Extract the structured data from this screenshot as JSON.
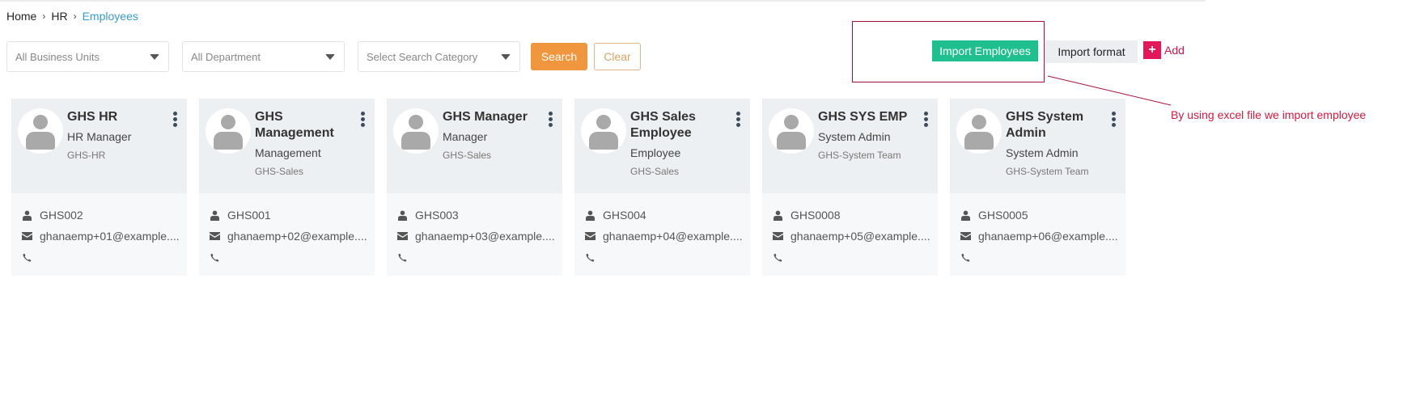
{
  "breadcrumb": [
    {
      "label": "Home"
    },
    {
      "label": "HR"
    },
    {
      "label": "Employees",
      "active": true
    }
  ],
  "breadcrumb_separator": "›",
  "filters": {
    "business_unit": {
      "value": "All Business Units"
    },
    "department": {
      "value": "All Department"
    },
    "search_category": {
      "placeholder": "Select Search Category"
    }
  },
  "buttons": {
    "search": "Search",
    "clear": "Clear",
    "import_employees": "Import Employees",
    "import_format": "Import format",
    "add": "Add",
    "add_icon": "+"
  },
  "annotation": {
    "text": "By using excel file we import employee",
    "color": "#d11a40"
  },
  "colors": {
    "search": "#ef963e",
    "import": "#1fbf8f",
    "add": "#e3175a",
    "breadcrumb_active": "#3a9ad0"
  },
  "employees": [
    {
      "name": "GHS HR",
      "role": "HR Manager",
      "unit": "GHS-HR",
      "code": "GHS002",
      "email": "ghanaemp+01@example....",
      "phone": ""
    },
    {
      "name": "GHS Management",
      "role": "Management",
      "unit": "GHS-Sales",
      "code": "GHS001",
      "email": "ghanaemp+02@example....",
      "phone": ""
    },
    {
      "name": "GHS Manager",
      "role": "Manager",
      "unit": "GHS-Sales",
      "code": "GHS003",
      "email": "ghanaemp+03@example....",
      "phone": ""
    },
    {
      "name": "GHS Sales Employee",
      "role": "Employee",
      "unit": "GHS-Sales",
      "code": "GHS004",
      "email": "ghanaemp+04@example....",
      "phone": ""
    },
    {
      "name": "GHS SYS EMP",
      "role": "System Admin",
      "unit": "GHS-System Team",
      "code": "GHS0008",
      "email": "ghanaemp+05@example....",
      "phone": ""
    },
    {
      "name": "GHS System Admin",
      "role": "System Admin",
      "unit": "GHS-System Team",
      "code": "GHS0005",
      "email": "ghanaemp+06@example....",
      "phone": ""
    }
  ]
}
